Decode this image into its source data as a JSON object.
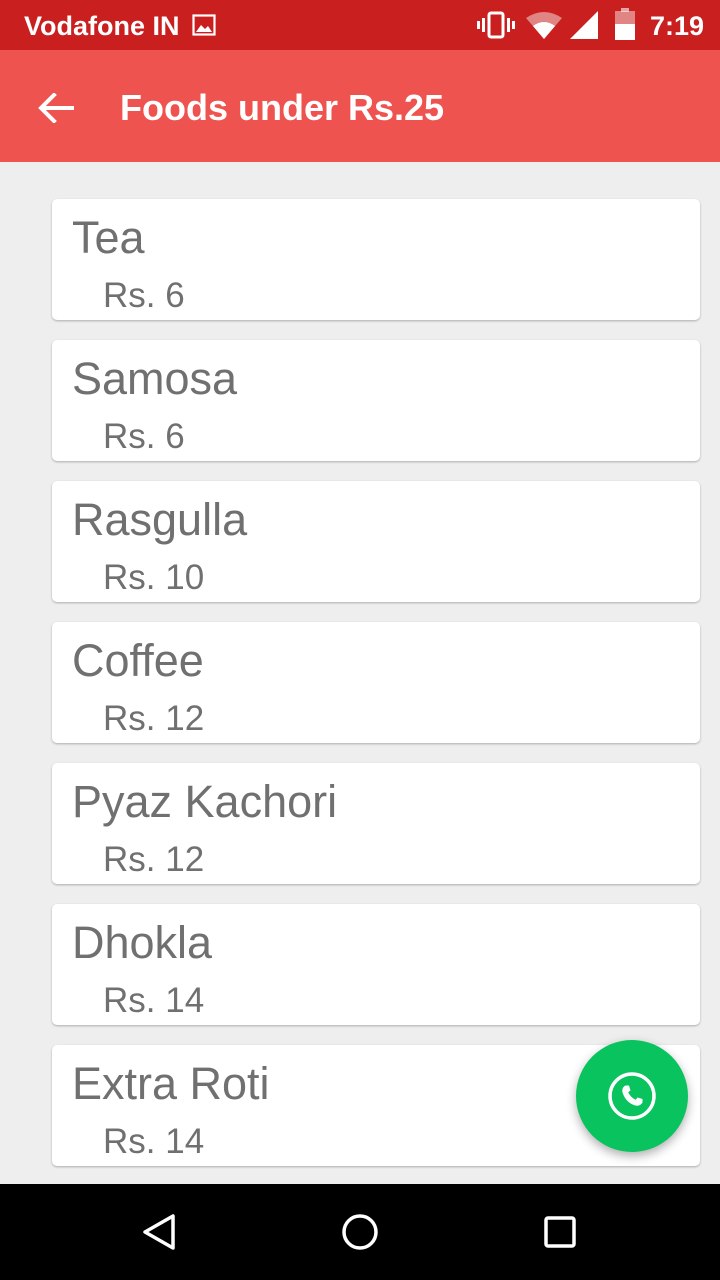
{
  "status_bar": {
    "carrier": "Vodafone IN",
    "time": "7:19",
    "icons": [
      "gallery-icon",
      "vibrate-icon",
      "wifi-icon",
      "signal-icon",
      "battery-icon"
    ]
  },
  "app_bar": {
    "back_icon": "arrow-left-icon",
    "title": "Foods under Rs.25",
    "color": "#ef5350"
  },
  "foods": [
    {
      "name": "Tea",
      "price": "Rs. 6"
    },
    {
      "name": "Samosa",
      "price": "Rs. 6"
    },
    {
      "name": "Rasgulla",
      "price": "Rs. 10"
    },
    {
      "name": "Coffee",
      "price": "Rs. 12"
    },
    {
      "name": "Pyaz Kachori",
      "price": "Rs. 12"
    },
    {
      "name": "Dhokla",
      "price": "Rs. 14"
    },
    {
      "name": "Extra Roti",
      "price": "Rs. 14"
    }
  ],
  "fab": {
    "icon": "phone-icon",
    "color": "#09c35e"
  },
  "nav_bar": {
    "icons": [
      "back-triangle-icon",
      "home-circle-icon",
      "recents-square-icon"
    ]
  }
}
